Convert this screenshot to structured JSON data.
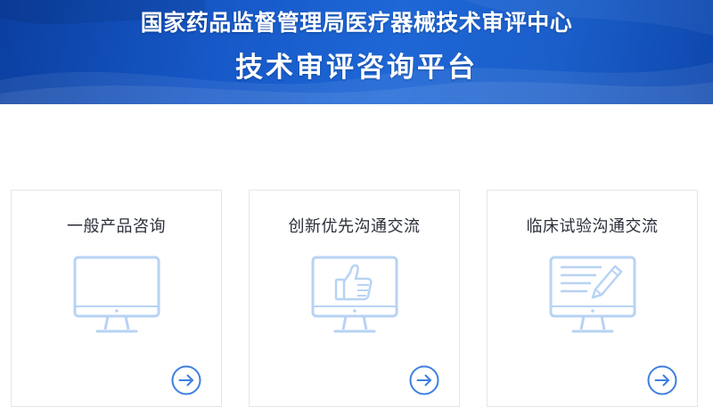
{
  "header": {
    "title": "国家药品监督管理局医疗器械技术审评中心",
    "subtitle": "技术审评咨询平台"
  },
  "cards": [
    {
      "label": "一般产品咨询",
      "icon": "monitor-icon"
    },
    {
      "label": "创新优先沟通交流",
      "icon": "monitor-thumbs-up-icon"
    },
    {
      "label": "临床试验沟通交流",
      "icon": "monitor-document-edit-icon"
    }
  ],
  "colors": {
    "banner_dark": "#0b3fa0",
    "banner_light": "#1e67d6",
    "illustration": "#b7d3f4",
    "arrow": "#3d7fe0",
    "card_border": "#e2e6ec",
    "card_text": "#2a2f3a"
  }
}
